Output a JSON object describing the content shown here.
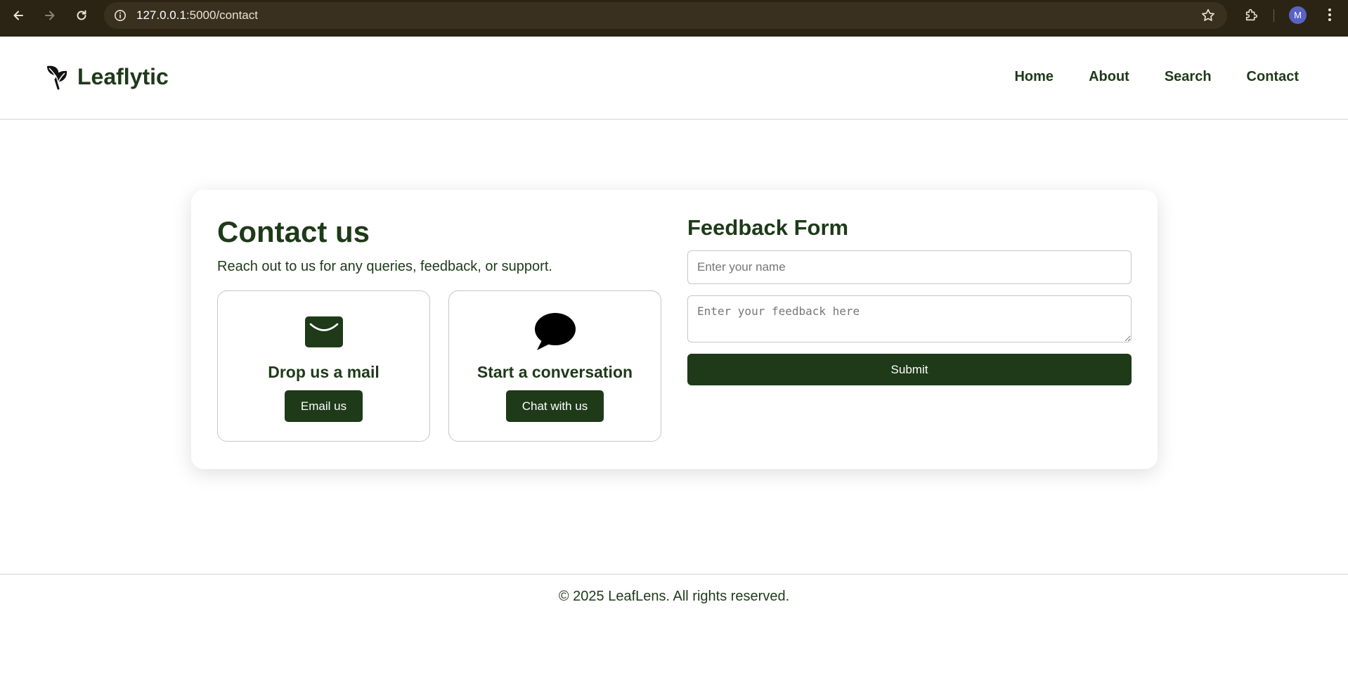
{
  "browser": {
    "url_host": "127.0.0.1",
    "url_path": ":5000/contact",
    "profile_initial": "M",
    "icons": [
      "back-arrow-icon",
      "forward-arrow-icon",
      "reload-icon",
      "site-info-icon",
      "bookmark-star-icon",
      "extensions-icon",
      "menu-dots-icon"
    ]
  },
  "header": {
    "brand": "Leaflytic",
    "logo_icon": "leaf-icon",
    "nav": [
      "Home",
      "About",
      "Search",
      "Contact"
    ]
  },
  "contact": {
    "title": "Contact us",
    "subtitle": "Reach out to us for any queries, feedback, or support.",
    "options": [
      {
        "icon": "envelope-icon",
        "title": "Drop us a mail",
        "button": "Email us"
      },
      {
        "icon": "speech-bubble-icon",
        "title": "Start a conversation",
        "button": "Chat with us"
      }
    ]
  },
  "feedback_form": {
    "title": "Feedback Form",
    "name_placeholder": "Enter your name",
    "feedback_placeholder": "Enter your feedback here",
    "submit_label": "Submit"
  },
  "footer": {
    "text": "© 2025 LeafLens. All rights reserved."
  },
  "colors": {
    "brand_green": "#1e3a19",
    "chrome_bg": "#2b2414",
    "avatar_bg": "#5a63c4"
  }
}
